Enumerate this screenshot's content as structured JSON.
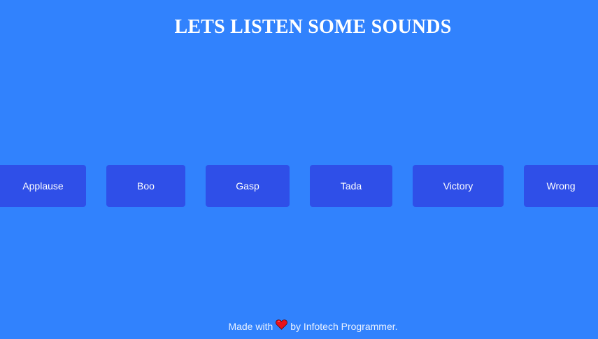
{
  "page": {
    "title": "LETS LISTEN SOME SOUNDS"
  },
  "buttons": [
    {
      "label": "Applause"
    },
    {
      "label": "Boo"
    },
    {
      "label": "Gasp"
    },
    {
      "label": "Tada"
    },
    {
      "label": "Victory"
    },
    {
      "label": "Wrong"
    }
  ],
  "footer": {
    "prefix": "Made with",
    "icon": "heart-icon",
    "suffix": "by Infotech Programmer."
  },
  "colors": {
    "background": "#3182fd",
    "button": "#2f4fe8",
    "heart": "#e8121c"
  }
}
